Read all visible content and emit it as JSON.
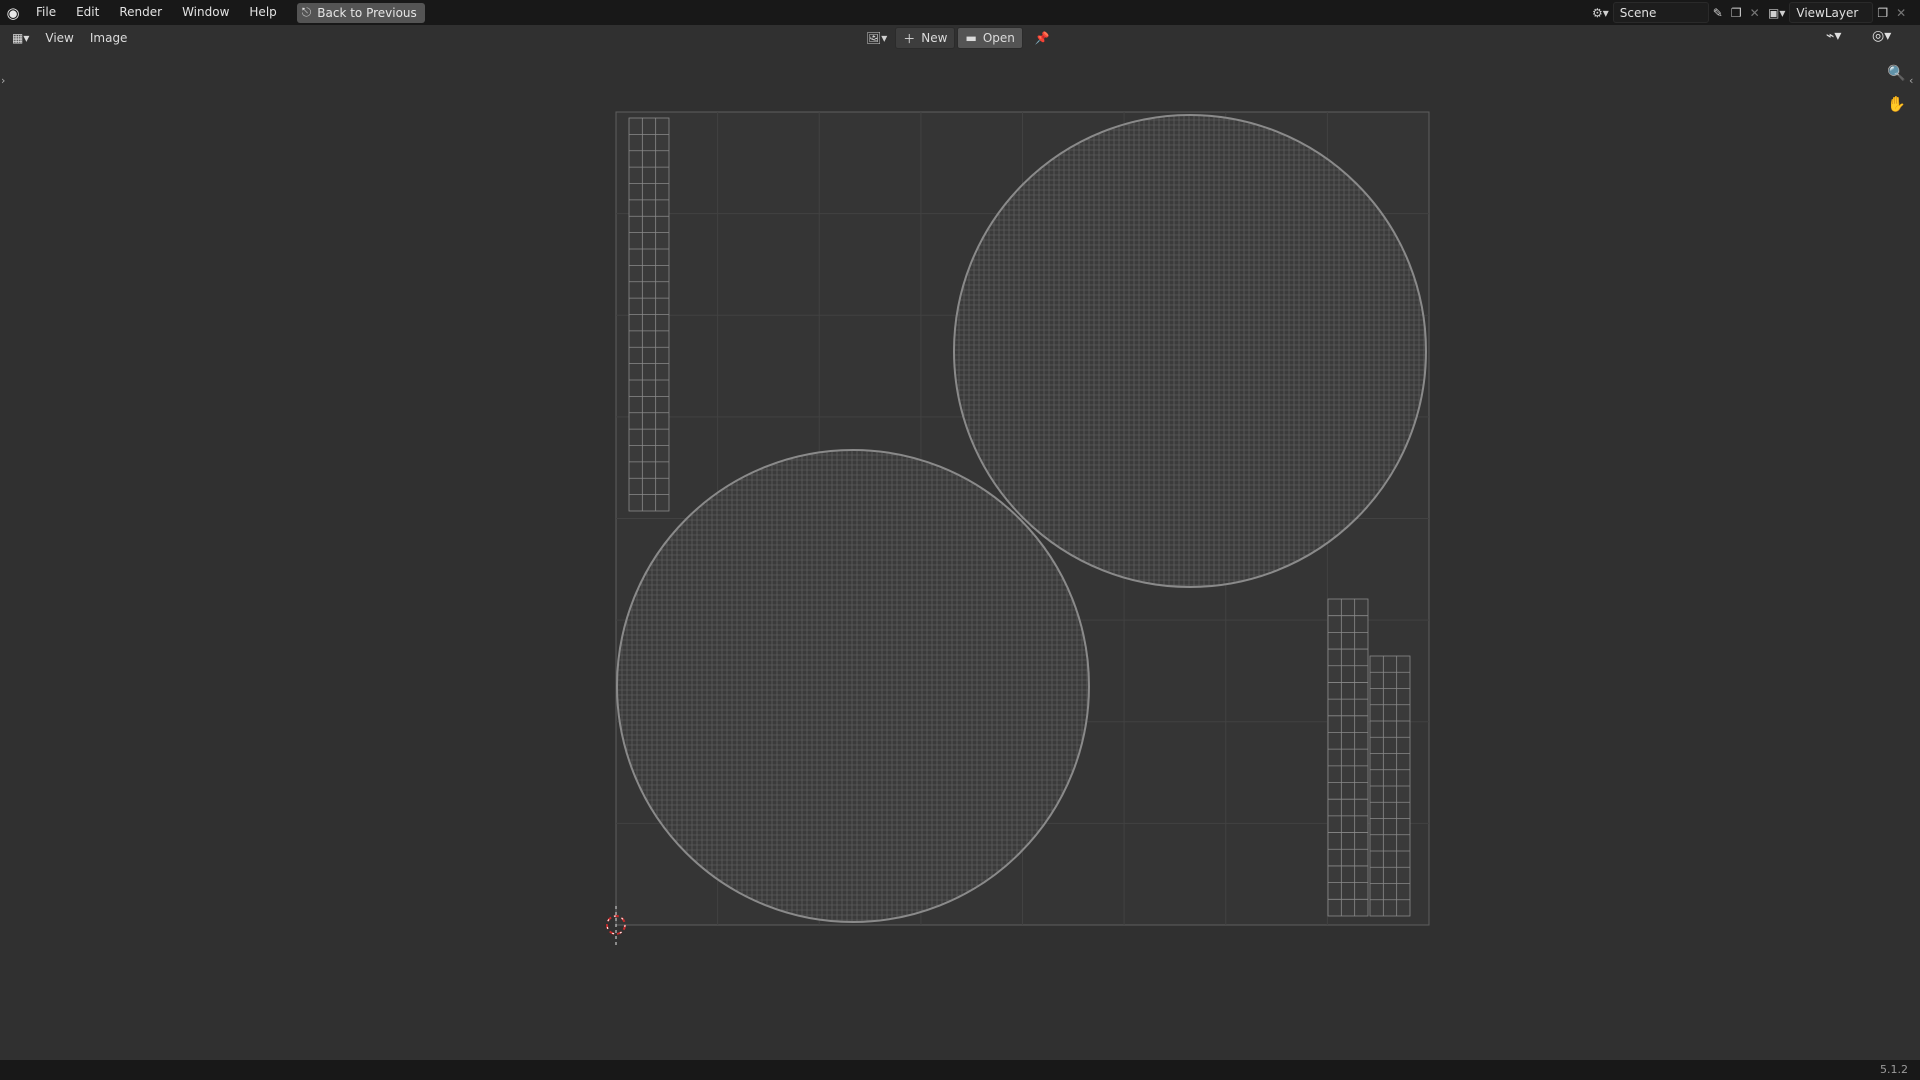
{
  "topbar": {
    "logo": "blender-logo-icon",
    "menus": [
      "File",
      "Edit",
      "Render",
      "Window",
      "Help"
    ],
    "back_button": "Back to Previous",
    "scene": "Scene",
    "view_layer": "ViewLayer"
  },
  "editor_header": {
    "editor_type_icon": "uv-editor-icon",
    "menus": [
      "View",
      "Image"
    ],
    "new_label": "New",
    "open_label": "Open"
  },
  "viewport": {
    "uv_islands": [
      "sphere-1",
      "sphere-2",
      "strip-left",
      "strip-right-a",
      "strip-right-b"
    ],
    "colors": {
      "background": "#303030",
      "grid_line": "#424242",
      "wire": "#8a8a8a",
      "cursor": "#c62b2b"
    }
  },
  "status": {
    "version": "5.1.2"
  }
}
